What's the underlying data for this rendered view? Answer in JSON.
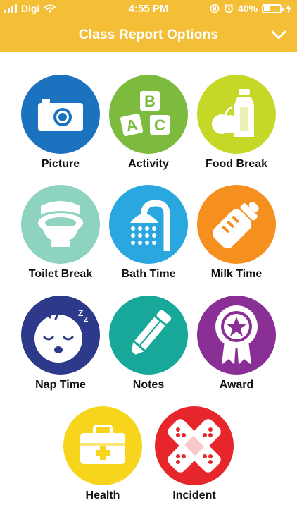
{
  "status_bar": {
    "carrier": "Digi",
    "time": "4:55 PM",
    "battery_percent": "40%",
    "battery_level": 0.4
  },
  "header": {
    "title": "Class Report Options",
    "collapse_icon": "chevron-down-icon",
    "background": "#f4bf36"
  },
  "options": [
    {
      "label": "Picture",
      "icon": "camera-icon",
      "color": "#1b73c0"
    },
    {
      "label": "Activity",
      "icon": "abc-blocks-icon",
      "color": "#7dbb3f"
    },
    {
      "label": "Food Break",
      "icon": "food-icon",
      "color": "#c6d827"
    },
    {
      "label": "Toilet Break",
      "icon": "toilet-icon",
      "color": "#8ed2c0"
    },
    {
      "label": "Bath Time",
      "icon": "shower-icon",
      "color": "#2aa7df"
    },
    {
      "label": "Milk Time",
      "icon": "baby-bottle-icon",
      "color": "#f5901f"
    },
    {
      "label": "Nap Time",
      "icon": "sleeping-baby-icon",
      "color": "#2d3a8c"
    },
    {
      "label": "Notes",
      "icon": "pencil-icon",
      "color": "#17a89a"
    },
    {
      "label": "Award",
      "icon": "award-ribbon-icon",
      "color": "#8a2f96"
    },
    {
      "label": "Health",
      "icon": "first-aid-kit-icon",
      "color": "#f7d51c"
    },
    {
      "label": "Incident",
      "icon": "bandage-icon",
      "color": "#e6262b"
    }
  ]
}
